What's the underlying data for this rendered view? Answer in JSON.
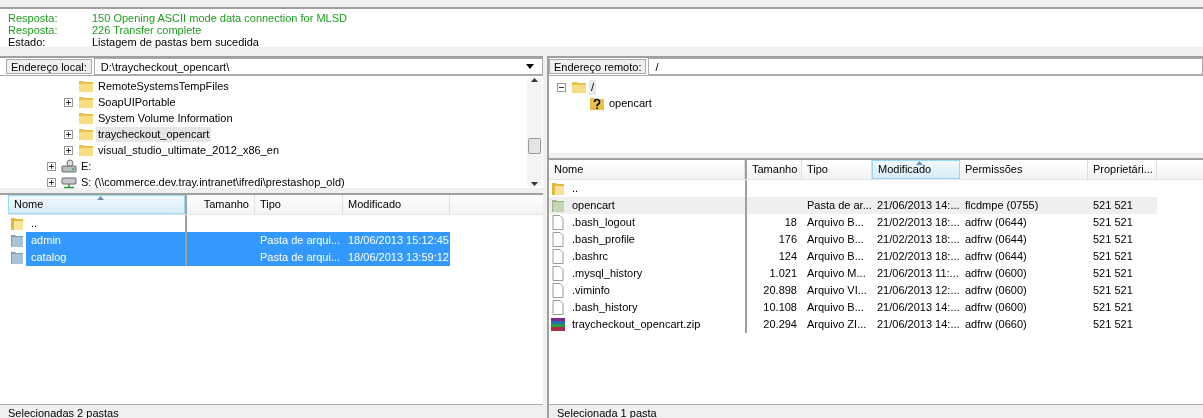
{
  "log": [
    {
      "kind": "response",
      "label": "Resposta:",
      "message": "150 Opening ASCII mode data connection for MLSD"
    },
    {
      "kind": "response",
      "label": "Resposta:",
      "message": "226 Transfer complete"
    },
    {
      "kind": "status",
      "label": "Estado:",
      "message": "Listagem de pastas bem sucedida"
    }
  ],
  "local": {
    "address_label": "Endereço local:",
    "address": "D:\\traycheckout_opencart\\",
    "tree": {
      "folders": [
        {
          "name": "RemoteSystemsTempFiles",
          "expandable": false,
          "selected": false
        },
        {
          "name": "SoapUIPortable",
          "expandable": true,
          "selected": false
        },
        {
          "name": "System Volume Information",
          "expandable": false,
          "selected": false
        },
        {
          "name": "traycheckout_opencart",
          "expandable": true,
          "selected": true
        },
        {
          "name": "visual_studio_ultimate_2012_x86_en",
          "expandable": true,
          "selected": false
        }
      ],
      "drives": [
        {
          "kind": "local",
          "name": "E:"
        },
        {
          "kind": "network",
          "name": "S: (\\\\commerce.dev.tray.intranet\\ifredi\\prestashop_old)"
        }
      ]
    },
    "list": {
      "active": true,
      "columns": [
        {
          "label": "Nome",
          "sorted": true
        },
        {
          "label": "Tamanho",
          "sorted": false
        },
        {
          "label": "Tipo",
          "sorted": false
        },
        {
          "label": "Modificado",
          "sorted": false
        }
      ],
      "rows": [
        {
          "kind": "parent",
          "cells": [
            ".."
          ],
          "selected": false
        },
        {
          "kind": "folder",
          "cells": [
            "admin",
            "",
            "Pasta de arqui...",
            "18/06/2013 15:12:45"
          ],
          "selected": true
        },
        {
          "kind": "folder",
          "cells": [
            "catalog",
            "",
            "Pasta de arqui...",
            "18/06/2013 13:59:12"
          ],
          "selected": true
        }
      ]
    },
    "status_bar": "Selecionadas 2 pastas"
  },
  "remote": {
    "address_label": "Endereço remoto:",
    "address": "/",
    "tree": {
      "name": "/",
      "expanded": true,
      "children": [
        {
          "name": "opencart",
          "kind": "unknown"
        }
      ]
    },
    "list": {
      "active": false,
      "columns": [
        {
          "label": "Nome",
          "sorted": false
        },
        {
          "label": "Tamanho",
          "sorted": false
        },
        {
          "label": "Tipo",
          "sorted": false
        },
        {
          "label": "Modificado",
          "sorted": true
        },
        {
          "label": "Permissões",
          "sorted": false
        },
        {
          "label": "Proprietári...",
          "sorted": false
        }
      ],
      "rows": [
        {
          "kind": "parent",
          "cells": [
            ".."
          ],
          "selected": false
        },
        {
          "kind": "folder",
          "cells": [
            "opencart",
            "",
            "Pasta de ar...",
            "21/06/2013 14:...",
            "flcdmpe (0755)",
            "521 521"
          ],
          "selected": true
        },
        {
          "kind": "file",
          "cells": [
            ".bash_logout",
            "18",
            "Arquivo B...",
            "21/02/2013 18:...",
            "adfrw (0644)",
            "521 521"
          ],
          "selected": false
        },
        {
          "kind": "file",
          "cells": [
            ".bash_profile",
            "176",
            "Arquivo B...",
            "21/02/2013 18:...",
            "adfrw (0644)",
            "521 521"
          ],
          "selected": false
        },
        {
          "kind": "file",
          "cells": [
            ".bashrc",
            "124",
            "Arquivo B...",
            "21/02/2013 18:...",
            "adfrw (0644)",
            "521 521"
          ],
          "selected": false
        },
        {
          "kind": "file",
          "cells": [
            ".mysql_history",
            "1.021",
            "Arquivo M...",
            "21/06/2013 11:...",
            "adfrw (0600)",
            "521 521"
          ],
          "selected": false
        },
        {
          "kind": "file",
          "cells": [
            ".viminfo",
            "20.898",
            "Arquivo VI...",
            "21/06/2013 12:...",
            "adfrw (0600)",
            "521 521"
          ],
          "selected": false
        },
        {
          "kind": "file",
          "cells": [
            ".bash_history",
            "10.108",
            "Arquivo B...",
            "21/06/2013 14:...",
            "adfrw (0600)",
            "521 521"
          ],
          "selected": false
        },
        {
          "kind": "archive",
          "cells": [
            "traycheckout_opencart.zip",
            "20.294",
            "Arquivo ZI...",
            "21/06/2013 14:...",
            "adfrw (0660)",
            "521 521"
          ],
          "selected": false
        }
      ]
    },
    "status_bar": "Selecionada 1 pasta"
  }
}
